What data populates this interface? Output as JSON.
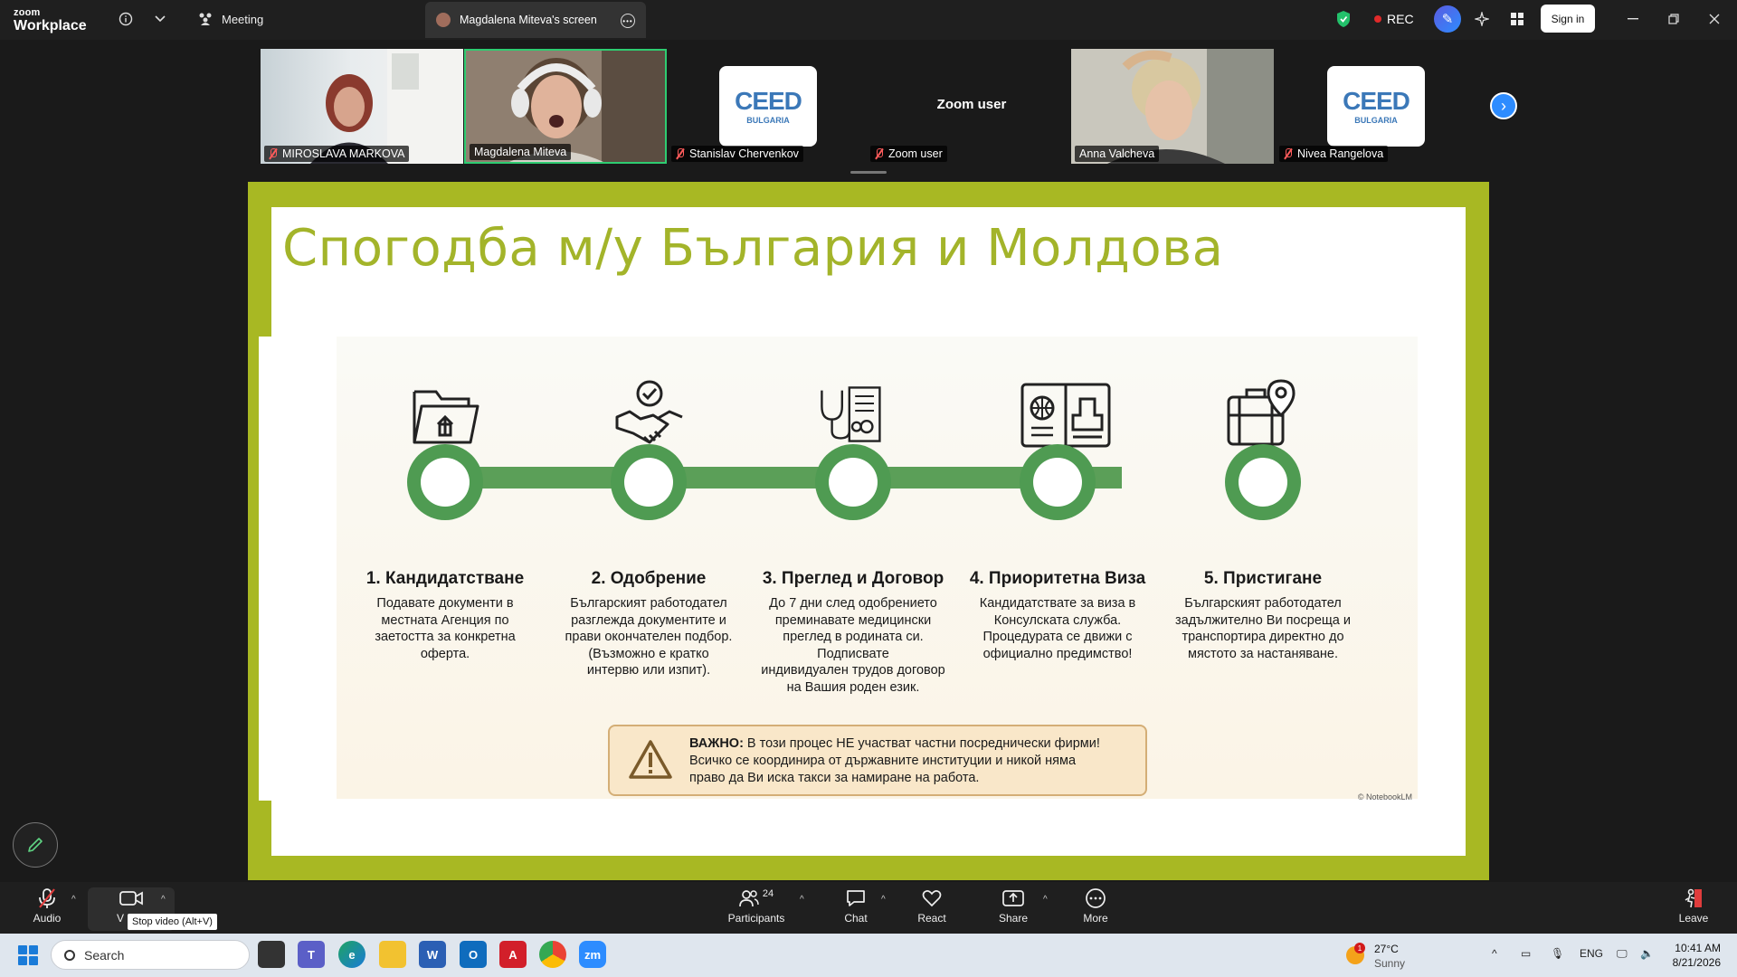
{
  "app": {
    "brand_top": "zoom",
    "brand_bottom": "Workplace"
  },
  "header": {
    "meeting_label": "Meeting",
    "screen_tab_title": "Magdalena Miteva's screen",
    "rec_label": "REC",
    "signin_label": "Sign in"
  },
  "participants_strip": [
    {
      "name": "MIROSLAVA MARKOVA",
      "muted": true,
      "kind": "video"
    },
    {
      "name": "Magdalena Miteva",
      "muted": false,
      "kind": "video",
      "active_speaker": true
    },
    {
      "name": "Stanislav Chervenkov",
      "muted": true,
      "kind": "logo"
    },
    {
      "name": "Zoom user",
      "muted": true,
      "kind": "name",
      "center_label": "Zoom user"
    },
    {
      "name": "Anna Valcheva",
      "muted": false,
      "kind": "video"
    },
    {
      "name": "Nivea Rangelova",
      "muted": true,
      "kind": "logo"
    }
  ],
  "ceed_logo": {
    "line1": "CEED",
    "line2": "BULGARIA"
  },
  "slide": {
    "title": "Спогодба м/у България и Молдова",
    "steps": [
      {
        "title": "1. Кандидатстване",
        "desc_lines": [
          "Подавате документи в",
          "местната Агенция по",
          "заетостта за конкретна",
          "оферта."
        ],
        "icon": "folder-upload-icon"
      },
      {
        "title": "2. Одобрение",
        "desc_lines": [
          "Българският работодател",
          "разглежда документите и",
          "прави окончателен подбор.",
          "(Възможно е кратко",
          "интервю или изпит)."
        ],
        "icon": "handshake-check-icon"
      },
      {
        "title": "3. Преглед и Договор",
        "desc_lines": [
          "До 7 дни след одобрението",
          "преминавате медицински",
          "преглед в родината си.",
          "Подписвате",
          "индивидуален трудов договор",
          "на Вашия роден език."
        ],
        "icon": "stethoscope-document-icon"
      },
      {
        "title": "4. Приоритетна Виза",
        "desc_lines": [
          "Кандидатствате за виза в",
          "Консулската служба.",
          "Процедурата се движи с",
          "официално предимство!"
        ],
        "icon": "passport-stamp-icon"
      },
      {
        "title": "5. Пристигане",
        "desc_lines": [
          "Българският работодател",
          "задължително Ви посреща и",
          "транспортира директно до",
          "мястото за настаняване."
        ],
        "icon": "suitcase-location-icon"
      }
    ],
    "warning": {
      "bold": "ВАЖНО:",
      "line1_rest": " В този процес НЕ участват частни посреднически фирми!",
      "line2": "Всичко се координира от държавните институции и никой няма",
      "line3": "право да Ви иска такси за намиране на работа."
    },
    "credit": "© NotebookLM"
  },
  "toolbar": {
    "audio_label": "Audio",
    "video_label": "V",
    "video_tooltip": "Stop video (Alt+V)",
    "participants_label": "Participants",
    "participants_count": "24",
    "chat_label": "Chat",
    "react_label": "React",
    "share_label": "Share",
    "more_label": "More",
    "leave_label": "Leave"
  },
  "taskbar": {
    "search_placeholder": "Search",
    "weather_temp": "27°C",
    "weather_cond": "Sunny",
    "weather_badge": "1",
    "lang": "ENG",
    "time": "10:41 AM",
    "date": "8/21/2026"
  },
  "colors": {
    "accent": "#2d8cff",
    "slide_green": "#a8b823",
    "timeline_green": "#4f9b52",
    "rec_red": "#e02a2a"
  }
}
